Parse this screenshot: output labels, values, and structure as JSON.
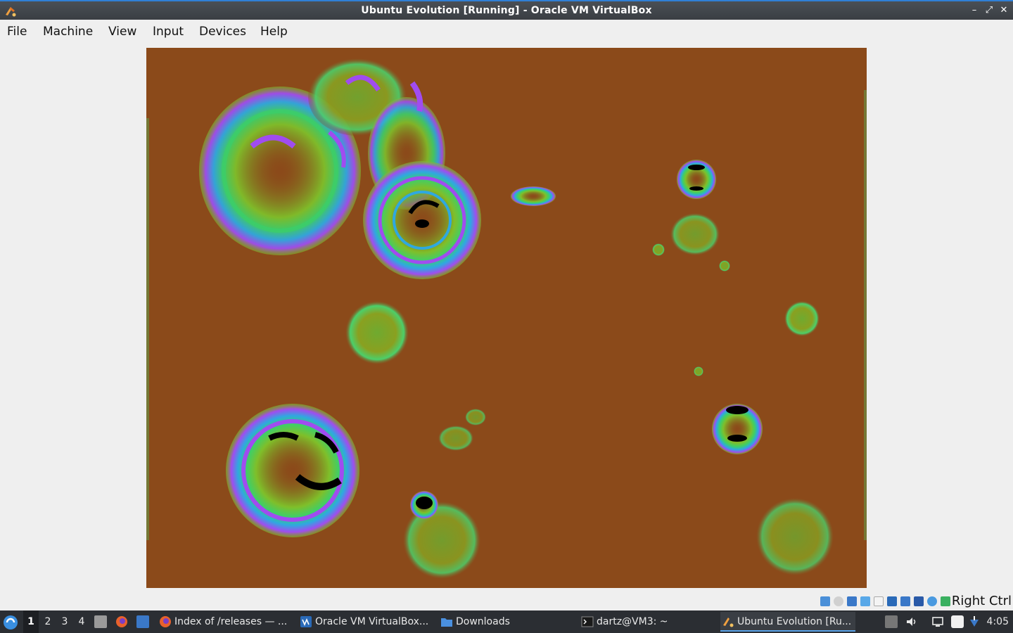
{
  "window": {
    "title": "Ubuntu Evolution [Running] - Oracle VM VirtualBox",
    "minimize_glyph": "–",
    "restore_glyph": "⤢",
    "close_glyph": "✕"
  },
  "menubar": {
    "items": [
      "File",
      "Machine",
      "View",
      "Input",
      "Devices",
      "Help"
    ]
  },
  "vm_display": {
    "background_color": "#8b4a1a",
    "content": "Animated bubble screensaver rendered in psychedelic green / blue / purple palette"
  },
  "statusbar": {
    "icons": [
      "hard-disk-icon",
      "optical-disk-icon",
      "audio-icon",
      "network-icon",
      "usb-icon",
      "shared-folders-icon",
      "display-icon",
      "video-capture-icon",
      "cpu-icon",
      "mouse-integration-icon",
      "keyboard-icon"
    ],
    "host_key": "Right Ctrl"
  },
  "taskbar": {
    "workspaces": [
      "1",
      "2",
      "3",
      "4"
    ],
    "active_workspace": "1",
    "tasks": [
      {
        "label": "Index of /releases — ...",
        "icon": "firefox-icon"
      },
      {
        "label": "Oracle VM VirtualBox...",
        "icon": "virtualbox-icon"
      },
      {
        "label": "Downloads",
        "icon": "folder-icon"
      },
      {
        "label": "dartz@VM3: ~",
        "icon": "terminal-icon"
      },
      {
        "label": "Ubuntu Evolution [Ru...",
        "icon": "virtualbox-vm-icon",
        "active": true
      }
    ],
    "clock": "4:05"
  }
}
